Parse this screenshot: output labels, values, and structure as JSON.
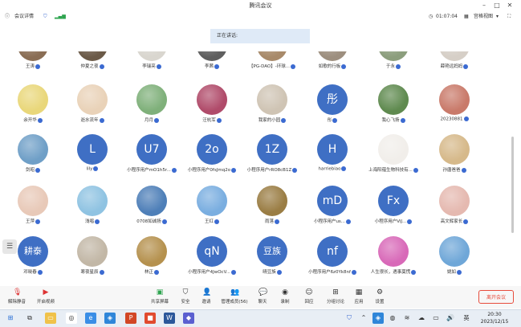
{
  "window": {
    "title": "腾讯会议"
  },
  "infobar": {
    "meeting_details": "会议详情",
    "timer": "01:07:04",
    "view_mode": "宫格视图"
  },
  "speaking": {
    "label": "正在讲话:"
  },
  "participants": [
    {
      "name": "王涛",
      "initials": "",
      "row": 0,
      "col": 0,
      "color": "#8a6e55"
    },
    {
      "name": "仲夏之夜",
      "initials": "",
      "row": 0,
      "col": 1,
      "color": "#6b5a48"
    },
    {
      "name": "李瑞亮",
      "initials": "",
      "row": 0,
      "col": 2,
      "color": "#d9d6cf"
    },
    {
      "name": "李茜",
      "initials": "",
      "row": 0,
      "col": 3,
      "color": "#5f5f5f"
    },
    {
      "name": "【PG-DAO】-环球...",
      "initials": "",
      "row": 0,
      "col": 4,
      "color": "#a88a6a"
    },
    {
      "name": "如歌的行板",
      "initials": "",
      "row": 0,
      "col": 5,
      "color": "#9d8f7f"
    },
    {
      "name": "于永",
      "initials": "",
      "row": 0,
      "col": 6,
      "color": "#8c9e7d"
    },
    {
      "name": "薛艳远妈妈",
      "initials": "",
      "row": 0,
      "col": 7,
      "color": "#d6cfc7"
    },
    {
      "name": "余开华",
      "initials": "",
      "row": 1,
      "col": 0,
      "color": "#e9d77a"
    },
    {
      "name": "逝水流年",
      "initials": "",
      "row": 1,
      "col": 1,
      "color": "#e9d2b8"
    },
    {
      "name": "月月",
      "initials": "",
      "row": 1,
      "col": 2,
      "color": "#7fb07a"
    },
    {
      "name": "汪杭军",
      "initials": "",
      "row": 1,
      "col": 3,
      "color": "#b04b6a"
    },
    {
      "name": "我家的小园",
      "initials": "",
      "row": 1,
      "col": 4,
      "color": "#cfc4b4"
    },
    {
      "name": "彤",
      "initials": "彤",
      "row": 1,
      "col": 5,
      "color": ""
    },
    {
      "name": "我心飞扬",
      "initials": "",
      "row": 1,
      "col": 6,
      "color": "#5f8a4f"
    },
    {
      "name": "20230881",
      "initials": "",
      "row": 1,
      "col": 7,
      "color": "#c97a6a"
    },
    {
      "name": "剑昭",
      "initials": "",
      "row": 2,
      "col": 0,
      "color": "#6f9fc7"
    },
    {
      "name": "lily",
      "initials": "L",
      "row": 2,
      "col": 1,
      "color": ""
    },
    {
      "name": "小程序用户mO1h5r...",
      "initials": "U7",
      "row": 2,
      "col": 2,
      "color": ""
    },
    {
      "name": "小程序用户0fsJmq2o",
      "initials": "2o",
      "row": 2,
      "col": 3,
      "color": ""
    },
    {
      "name": "小程序用户rRO8cB1Z",
      "initials": "1Z",
      "row": 2,
      "col": 4,
      "color": ""
    },
    {
      "name": "harriebiao",
      "initials": "H",
      "row": 2,
      "col": 5,
      "color": ""
    },
    {
      "name": "上海阳蕴生物科技有...",
      "initials": "",
      "row": 2,
      "col": 6,
      "color": "#f1eeea"
    },
    {
      "name": "孙唐爸爸",
      "initials": "",
      "row": 2,
      "col": 7,
      "color": "#d6b98a"
    },
    {
      "name": "王萍",
      "initials": "",
      "row": 3,
      "col": 0,
      "color": "#e8c9b8"
    },
    {
      "name": "浅唱",
      "initials": "",
      "row": 3,
      "col": 1,
      "color": "#8fc3e2"
    },
    {
      "name": "0708如诚扬",
      "initials": "",
      "row": 3,
      "col": 2,
      "color": "#4e7fb8"
    },
    {
      "name": "王红",
      "initials": "",
      "row": 3,
      "col": 3,
      "color": "#7aaee0"
    },
    {
      "name": "雨落",
      "initials": "",
      "row": 3,
      "col": 4,
      "color": "#9a7d44"
    },
    {
      "name": "小程序用户us...",
      "initials": "mD",
      "row": 3,
      "col": 5,
      "color": ""
    },
    {
      "name": "小程序用户ViJ...",
      "initials": "Fx",
      "row": 3,
      "col": 6,
      "color": ""
    },
    {
      "name": "高文辉家长",
      "initials": "",
      "row": 3,
      "col": 7,
      "color": "#e5b9b0"
    },
    {
      "name": "邓晓春",
      "initials": "耕泰",
      "row": 4,
      "col": 0,
      "color": ""
    },
    {
      "name": "寒夜星辰",
      "initials": "",
      "row": 4,
      "col": 1,
      "color": "#c2b7a6"
    },
    {
      "name": "林正",
      "initials": "",
      "row": 4,
      "col": 2,
      "color": "#b5914e"
    },
    {
      "name": "小程序用户4JwOcV...",
      "initials": "qN",
      "row": 4,
      "col": 3,
      "color": ""
    },
    {
      "name": "晴豆族",
      "initials": "豆族",
      "row": 4,
      "col": 4,
      "color": ""
    },
    {
      "name": "小程序用户6z0Yk8nf",
      "initials": "nf",
      "row": 4,
      "col": 5,
      "color": ""
    },
    {
      "name": "人生很长，遇事莫慌",
      "initials": "",
      "row": 4,
      "col": 6,
      "color": "#d869b8"
    },
    {
      "name": "姚如",
      "initials": "",
      "row": 4,
      "col": 7,
      "color": "#6fa7d8"
    }
  ],
  "toolbar": {
    "unmute": "解除静音",
    "video": "开启视频",
    "share": "共享屏幕",
    "security": "安全",
    "invite": "邀请",
    "members": "管理成员(56)",
    "chat": "聊天",
    "record": "录制",
    "reactions": "回应",
    "breakout": "分组讨论",
    "apps": "应用",
    "settings": "设置",
    "leave": "离开会议"
  },
  "taskbar": {
    "time": "20:30",
    "date": "2023/12/15",
    "lang": "英"
  },
  "colors": {
    "accent": "#3f6fc4",
    "leave": "#e74c3c"
  }
}
